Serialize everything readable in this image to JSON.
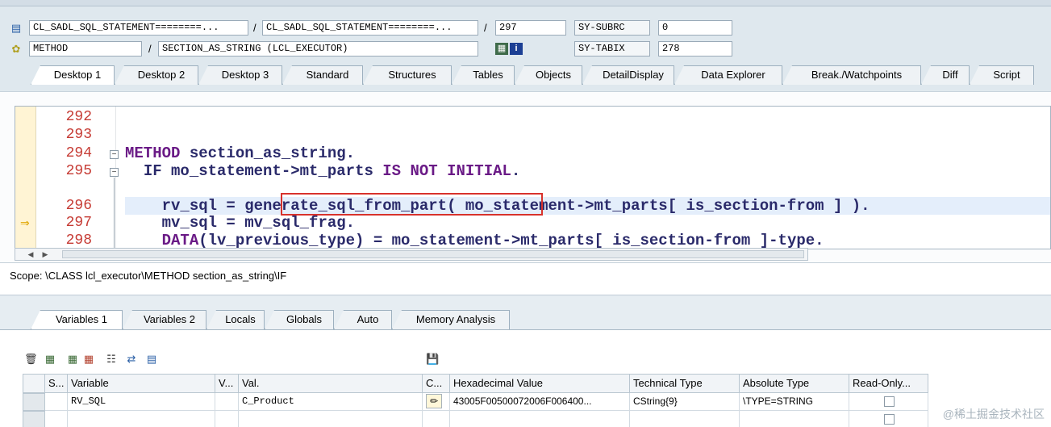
{
  "header": {
    "program": "CL_SADL_SQL_STATEMENT========...",
    "include": "CL_SADL_SQL_STATEMENT========...",
    "line": "297",
    "sysubrc_label": "SY-SUBRC",
    "sysubrc_value": "0",
    "event_type": "METHOD",
    "event_name": "SECTION_AS_STRING (LCL_EXECUTOR)",
    "sytabix_label": "SY-TABIX",
    "sytabix_value": "278"
  },
  "desktop_tabs": [
    "Desktop 1",
    "Desktop 2",
    "Desktop 3",
    "Standard",
    "Structures",
    "Tables",
    "Objects",
    "DetailDisplay",
    "Data Explorer",
    "Break./Watchpoints",
    "Diff",
    "Script"
  ],
  "code": {
    "lines": [
      {
        "no": "292",
        "text": ""
      },
      {
        "no": "293",
        "text": ""
      },
      {
        "no": "294",
        "kw": "METHOD",
        "rest": " section_as_string."
      },
      {
        "no": "295",
        "pre": "  ",
        "kw": "IF",
        "rest": " mo_statement->mt_parts ",
        "kw2": "IS NOT INITIAL",
        "tail": "."
      },
      {
        "no": "296",
        "text": "    rv_sql = generate_sql_from_part( mo_statement->mt_parts[ is_section-from ] )."
      },
      {
        "no": "297",
        "text": "    mv_sql = mv_sql_frag."
      },
      {
        "no": "298",
        "pre": "    ",
        "kw": "DATA",
        "rest": "(lv_previous_type) = mo_statement->mt_parts[ is_section-from ]-type."
      }
    ]
  },
  "scope": "Scope: \\CLASS lcl_executor\\METHOD section_as_string\\IF",
  "variable_tabs": [
    "Variables 1",
    "Variables 2",
    "Locals",
    "Globals",
    "Auto",
    "Memory Analysis"
  ],
  "grid": {
    "headers": [
      "S...",
      "Variable",
      "V...",
      "Val.",
      "C...",
      "Hexadecimal Value",
      "Technical Type",
      "Absolute Type",
      "Read-Only..."
    ],
    "rows": [
      {
        "variable": "RV_SQL",
        "value": "C_Product",
        "hex": "43005F00500072006F006400...",
        "tech": "CString{9}",
        "abs": "\\TYPE=STRING"
      }
    ]
  },
  "watermark": "@稀土掘金技术社区"
}
